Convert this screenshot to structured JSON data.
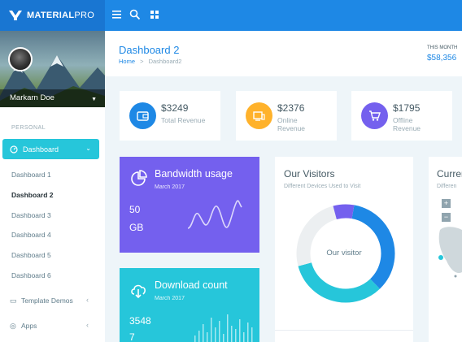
{
  "brand": {
    "name_bold": "MATERIAL",
    "name_light": "PRO"
  },
  "topbar": {
    "icons": [
      "menu-icon",
      "search-icon",
      "grid-icon"
    ]
  },
  "profile": {
    "name": "Markarn Doe"
  },
  "sidebar": {
    "section": "PERSONAL",
    "active": "Dashboard",
    "items": [
      "Dashboard 1",
      "Dashboard 2",
      "Dashboard 3",
      "Dashboard 4",
      "Dashboard 5",
      "Dashboard 6"
    ],
    "template_demos": "Template Demos",
    "apps": "Apps"
  },
  "header": {
    "title": "Dashboard 2",
    "crumb_home": "Home",
    "crumb_sep": ">",
    "crumb_current": "Dashboard2",
    "month_label": "THIS MONTH",
    "month_value": "$58,356"
  },
  "stats": [
    {
      "value": "$3249",
      "label": "Total Revenue",
      "color": "#1e88e5",
      "icon": "wallet-icon"
    },
    {
      "value": "$2376",
      "label": "Online Revenue",
      "color": "#ffb22b",
      "icon": "monitor-icon"
    },
    {
      "value": "$1795",
      "label": "Offline Revenue",
      "color": "#7460ee",
      "icon": "cart-icon"
    }
  ],
  "bandwidth": {
    "title": "Bandwidth usage",
    "date": "March 2017",
    "value": "50",
    "unit": "GB",
    "color": "#7460ee"
  },
  "download": {
    "title": "Download count",
    "date": "March 2017",
    "value_line1": "3548",
    "value_line2": "7",
    "color": "#26c6da"
  },
  "visitors": {
    "title": "Our Visitors",
    "subtitle": "Different Devices Used to Visit",
    "center_label": "Our visitor",
    "segments": [
      {
        "color": "#1e88e5",
        "fraction": 0.35
      },
      {
        "color": "#26c6da",
        "fraction": 0.33
      },
      {
        "color": "#eceff1",
        "fraction": 0.25
      },
      {
        "color": "#7460ee",
        "fraction": 0.07
      }
    ]
  },
  "map_card": {
    "title": "Curren",
    "subtitle": "Differen",
    "zoom_in": "+",
    "zoom_out": "−"
  }
}
